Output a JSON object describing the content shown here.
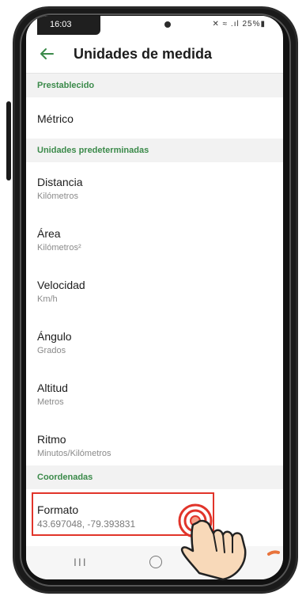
{
  "status_bar": {
    "time": "16:03",
    "icons": "✕ ≈ .ıl 25%▮"
  },
  "app_bar": {
    "title": "Unidades de medida"
  },
  "sections": {
    "preset": "Prestablecido",
    "default_units": "Unidades predeterminadas",
    "coordinates": "Coordenadas"
  },
  "preset_value": "Métrico",
  "units": [
    {
      "label": "Distancia",
      "value": "Kilómetros"
    },
    {
      "label": "Área",
      "value": "Kilómetros²"
    },
    {
      "label": "Velocidad",
      "value": "Km/h"
    },
    {
      "label": "Ángulo",
      "value": "Grados"
    },
    {
      "label": "Altitud",
      "value": "Metros"
    },
    {
      "label": "Ritmo",
      "value": "Minutos/Kilómetros"
    }
  ],
  "format": {
    "label": "Formato",
    "value": "43.697048, -79.393831"
  },
  "nav_bar": {
    "recent_glyph": "III"
  },
  "colors": {
    "accent": "#3b8a4a",
    "highlight": "#e1342a",
    "section_bg": "#f2f2f2"
  }
}
